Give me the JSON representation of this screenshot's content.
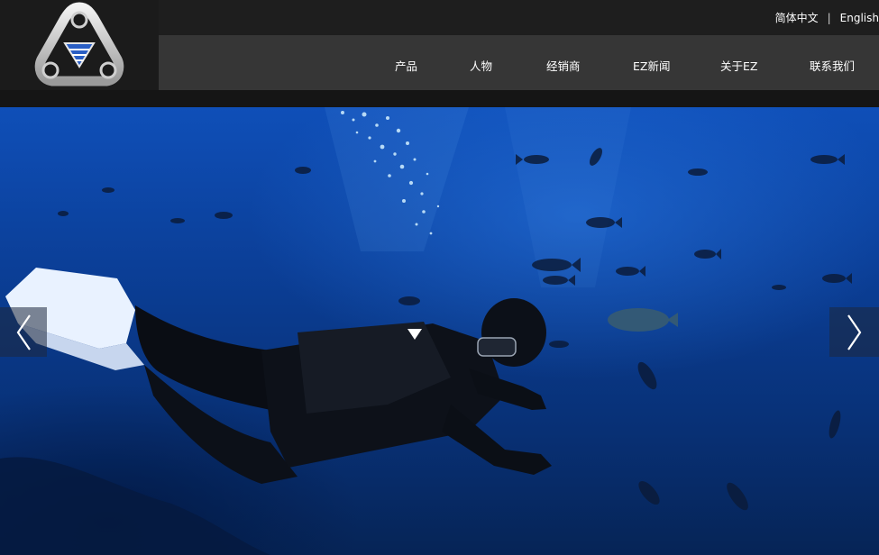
{
  "header": {
    "logo": {
      "icon": "ez-triangle-logo-icon",
      "accent": "#2a5ec4"
    },
    "lang": {
      "chinese": "简体中文",
      "separator": "|",
      "english": "English"
    },
    "nav": [
      {
        "label": "产品"
      },
      {
        "label": "人物"
      },
      {
        "label": "经销商"
      },
      {
        "label": "EZ新闻"
      },
      {
        "label": "关于EZ"
      },
      {
        "label": "联系我们"
      }
    ]
  },
  "hero": {
    "image": "scuba-diver-underwater-with-fish",
    "prev_icon": "chevron-left-icon",
    "next_icon": "chevron-right-icon"
  },
  "colors": {
    "topbar": "#1e1e1e",
    "navbar": "#363636",
    "ocean": "#0b3f98"
  }
}
